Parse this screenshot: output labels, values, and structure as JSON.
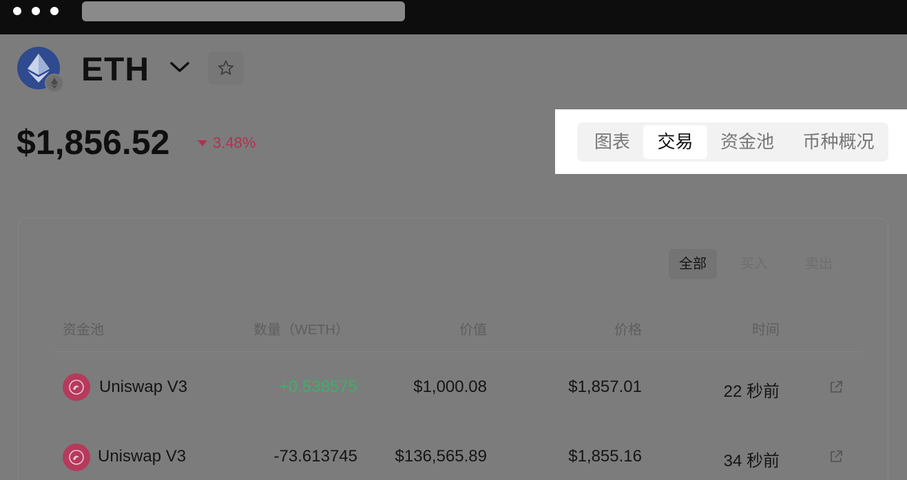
{
  "coin": {
    "symbol": "ETH",
    "price": "$1,856.52",
    "change": "3.48%",
    "change_color": "#b5304e"
  },
  "tabs": [
    {
      "label": "图表"
    },
    {
      "label": "交易"
    },
    {
      "label": "资金池"
    },
    {
      "label": "币种概况"
    }
  ],
  "active_tab": "交易",
  "filters": [
    {
      "label": "全部"
    },
    {
      "label": "买入"
    },
    {
      "label": "卖出"
    }
  ],
  "table": {
    "headers": [
      "资金池",
      "数量（WETH）",
      "价值",
      "价格",
      "时间"
    ],
    "rows": [
      {
        "pool": "Uniswap V3",
        "amount": "+0.538575",
        "value": "$1,000.08",
        "price": "$1,857.01",
        "time": "22 秒前"
      },
      {
        "pool": "Uniswap V3",
        "amount": "-73.613745",
        "value": "$136,565.89",
        "price": "$1,855.16",
        "time": "34 秒前"
      }
    ]
  },
  "icons": {
    "coin_logo": "ethereum-icon",
    "dropdown": "chevron-down-icon",
    "favorite": "star-icon",
    "pool": "uniswap-icon",
    "external": "external-link-icon"
  },
  "colors": {
    "positive": "#3fae6a",
    "negative": "#b5304e",
    "highlight": "#ffffff"
  }
}
